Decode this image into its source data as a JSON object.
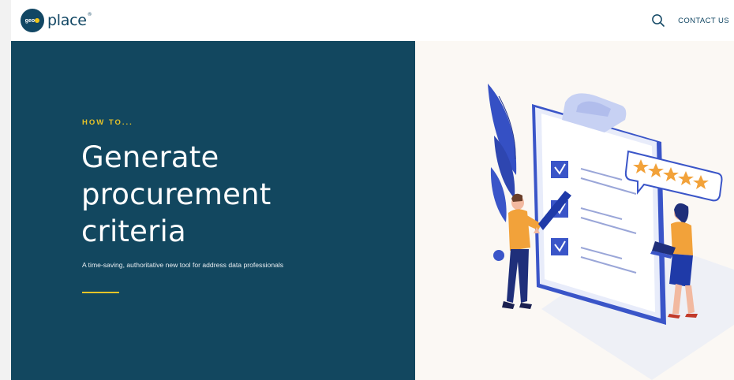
{
  "header": {
    "logo": {
      "prefix": "geo",
      "word": "place",
      "mark": "®"
    },
    "search_icon": "search-icon",
    "contact_label": "CONTACT US"
  },
  "hero": {
    "kicker": "HOW TO...",
    "headline_lines": [
      "Generate",
      "procurement",
      "criteria"
    ],
    "subtitle": "A time-saving, authoritative new tool for address data professionals",
    "accent_color": "#e8c428",
    "panel_color": "#12475f"
  },
  "illustration": {
    "name": "clipboard-checklist-illustration",
    "rating_stars": 5,
    "checklist_items": 3
  },
  "colors": {
    "brand": "#124764",
    "accent": "#e8c428",
    "illustration_blue": "#3a55c8",
    "illustration_orange": "#f2a23a"
  }
}
